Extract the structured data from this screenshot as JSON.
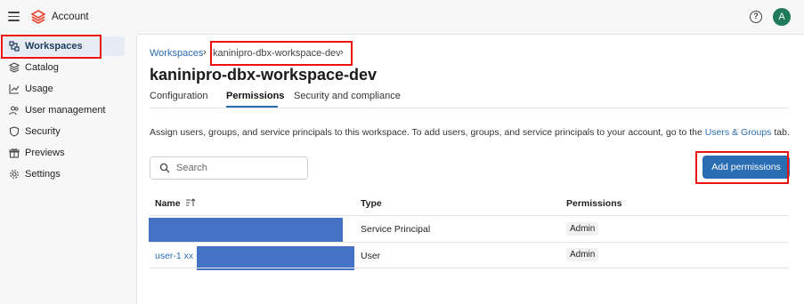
{
  "topbar": {
    "title": "Account",
    "help_icon": "?",
    "avatar_initial": "A"
  },
  "sidebar": {
    "items": [
      {
        "label": "Workspaces",
        "icon": "workspaces-icon",
        "active": true
      },
      {
        "label": "Catalog",
        "icon": "catalog-icon"
      },
      {
        "label": "Usage",
        "icon": "usage-icon"
      },
      {
        "label": "User management",
        "icon": "users-icon"
      },
      {
        "label": "Security",
        "icon": "shield-icon"
      },
      {
        "label": "Previews",
        "icon": "gift-icon"
      },
      {
        "label": "Settings",
        "icon": "gear-icon"
      }
    ]
  },
  "breadcrumb": {
    "root": "Workspaces",
    "sep": "›",
    "current": "kaninipro-dbx-workspace-dev"
  },
  "page": {
    "title": "kaninipro-dbx-workspace-dev"
  },
  "tabs": [
    {
      "label": "Configuration"
    },
    {
      "label": "Permissions",
      "active": true
    },
    {
      "label": "Security and compliance"
    }
  ],
  "description": {
    "text": "Assign users, groups, and service principals to this workspace. To add users, groups, and service principals to your account, go to the ",
    "link": "Users & Groups",
    "suffix": " tab."
  },
  "search": {
    "placeholder": "Search"
  },
  "actions": {
    "add_permissions": "Add permissions"
  },
  "table": {
    "columns": {
      "name": "Name",
      "type": "Type",
      "permissions": "Permissions"
    },
    "rows": [
      {
        "name": "",
        "type": "Service Principal",
        "permission": "Admin"
      },
      {
        "name": "user-1 xx (",
        "type": "User",
        "permission": "Admin"
      }
    ]
  },
  "colors": {
    "accent": "#2a6db3",
    "highlight": "#e11111",
    "redaction": "#4472c4"
  }
}
